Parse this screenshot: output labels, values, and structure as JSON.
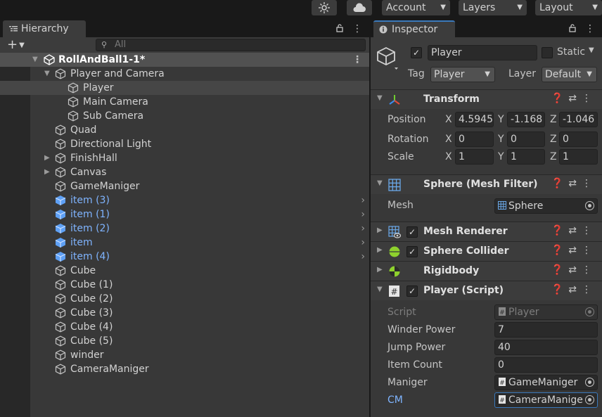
{
  "toolbar": {
    "account": "Account",
    "layers": "Layers",
    "layout": "Layout",
    "icons": [
      "light-icon",
      "cloud-icon"
    ]
  },
  "hierarchy": {
    "tab_label": "Hierarchy",
    "search_placeholder": "All",
    "scene_name": "RollAndBall1-1*",
    "items": [
      {
        "label": "Player and Camera",
        "depth": 1,
        "expanded": true
      },
      {
        "label": "Player",
        "depth": 2,
        "selected": true
      },
      {
        "label": "Main Camera",
        "depth": 2
      },
      {
        "label": "Sub Camera",
        "depth": 2
      },
      {
        "label": "Quad",
        "depth": 1
      },
      {
        "label": "Directional Light",
        "depth": 1
      },
      {
        "label": "FinishHall",
        "depth": 1,
        "collapsed": true
      },
      {
        "label": "Canvas",
        "depth": 1,
        "collapsed": true
      },
      {
        "label": "GameManiger",
        "depth": 1
      },
      {
        "label": "item (3)",
        "depth": 1,
        "prefab": true
      },
      {
        "label": "item (1)",
        "depth": 1,
        "prefab": true
      },
      {
        "label": "item (2)",
        "depth": 1,
        "prefab": true
      },
      {
        "label": "item",
        "depth": 1,
        "prefab": true
      },
      {
        "label": "item (4)",
        "depth": 1,
        "prefab": true
      },
      {
        "label": "Cube",
        "depth": 1
      },
      {
        "label": "Cube (1)",
        "depth": 1
      },
      {
        "label": "Cube (2)",
        "depth": 1
      },
      {
        "label": "Cube (3)",
        "depth": 1
      },
      {
        "label": "Cube (4)",
        "depth": 1
      },
      {
        "label": "Cube (5)",
        "depth": 1
      },
      {
        "label": "winder",
        "depth": 1
      },
      {
        "label": "CameraManiger",
        "depth": 1
      }
    ]
  },
  "inspector": {
    "tab_label": "Inspector",
    "object_name": "Player",
    "static_label": "Static",
    "tag_label": "Tag",
    "tag_value": "Player",
    "layer_label": "Layer",
    "layer_value": "Default",
    "transform": {
      "title": "Transform",
      "position_label": "Position",
      "rotation_label": "Rotation",
      "scale_label": "Scale",
      "position": {
        "x": "4.5945",
        "y": "-1.168",
        "z": "-1.046"
      },
      "rotation": {
        "x": "0",
        "y": "0",
        "z": "0"
      },
      "scale": {
        "x": "1",
        "y": "1",
        "z": "1"
      },
      "axes": {
        "x": "X",
        "y": "Y",
        "z": "Z"
      }
    },
    "mesh_filter": {
      "title": "Sphere (Mesh Filter)",
      "mesh_label": "Mesh",
      "mesh_value": "Sphere"
    },
    "mesh_renderer": {
      "title": "Mesh Renderer"
    },
    "sphere_collider": {
      "title": "Sphere Collider"
    },
    "rigidbody": {
      "title": "Rigidbody"
    },
    "player_script": {
      "title": "Player (Script)",
      "script_label": "Script",
      "script_value": "Player",
      "winder_power_label": "Winder Power",
      "winder_power_value": "7",
      "jump_power_label": "Jump Power",
      "jump_power_value": "40",
      "item_count_label": "Item Count",
      "item_count_value": "0",
      "maniger_label": "Maniger",
      "maniger_value": "GameManiger",
      "cm_label": "CM",
      "cm_value": "CameraManige"
    }
  },
  "colors": {
    "prefab_blue": "#7fb4ff",
    "selection": "#3a79bb",
    "panel": "#383838"
  }
}
